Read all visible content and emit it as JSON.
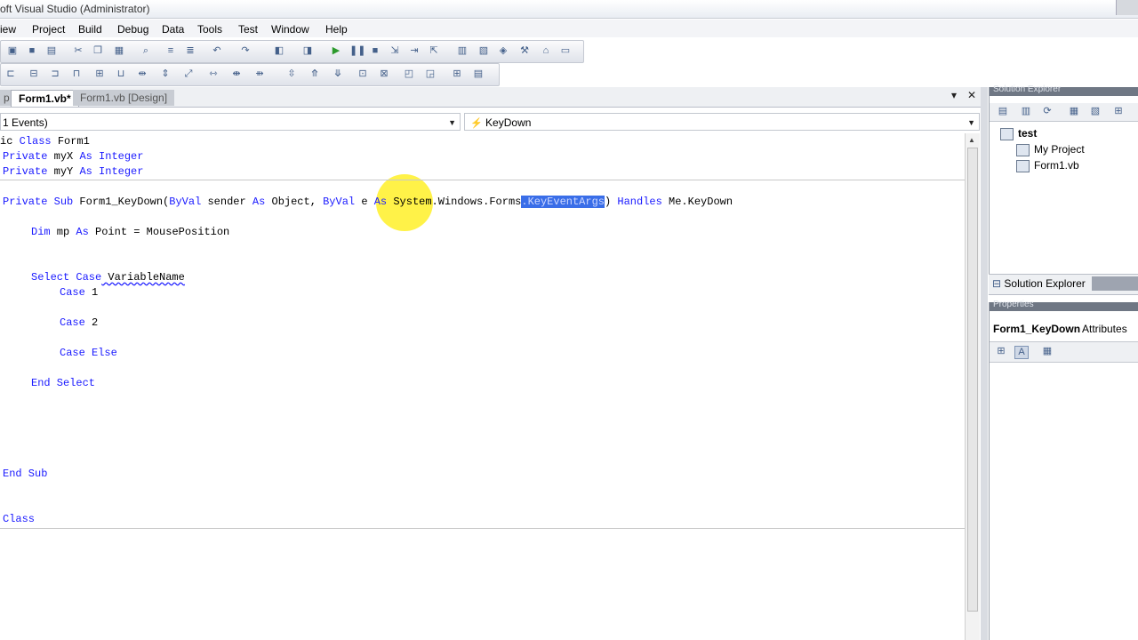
{
  "window": {
    "title": "oft Visual Studio (Administrator)"
  },
  "menu": [
    "iew",
    "Project",
    "Build",
    "Debug",
    "Data",
    "Tools",
    "Test",
    "Window",
    "Help"
  ],
  "tabs": {
    "active": "Form1.vb*",
    "inactive": "Form1.vb [Design]",
    "prefix": "p"
  },
  "dropdowns": {
    "class_name": "1 Events)",
    "method_name": "KeyDown"
  },
  "code": {
    "l1a": "ic ",
    "l1b": "Class",
    "l1c": " Form1",
    "l2a": "Private",
    "l2b": " myX ",
    "l2c": "As",
    "l2d": " ",
    "l2e": "Integer",
    "l3a": "Private",
    "l3b": " myY ",
    "l3c": "As",
    "l3d": " ",
    "l3e": "Integer",
    "l4_private": "Private",
    "l4_sub": " Sub",
    " l4_name": "",
    "l4_name": " Form1_KeyDown(",
    "l4_byval1": "ByVal",
    "l4_sender": " sender ",
    "l4_as1": "As",
    "l4_object": " Object, ",
    "l4_byval2": "ByVal",
    "l4_e": " e ",
    "l4_as2": "As",
    "l4_sys": " System.Windows.Forms",
    "l4_sel": ".KeyEventArgs",
    "l4_close": ") ",
    "l4_handles": "Handles",
    "l4_me": " Me.KeyDown",
    "l5_dim": "Dim",
    "l5_mp": " mp ",
    "l5_as": "As",
    "l5_rest": " Point = MousePosition",
    "l6_select": "Select Case",
    "l6_var": " VariableName",
    "l7": "Case",
    "l7v": " 1",
    "l8": "Case",
    "l8v": " 2",
    "l9": "Case Else",
    "l10": "End Select",
    "l11": "End Sub",
    "l12": "Class"
  },
  "solution_explorer": {
    "header": "Solution Explorer",
    "root": "test",
    "items": [
      "My Project",
      "Form1.vb"
    ],
    "tab_label": "Solution Explorer"
  },
  "properties": {
    "header": "Properties",
    "object": "Form1_KeyDown",
    "object_type": "Attributes"
  }
}
